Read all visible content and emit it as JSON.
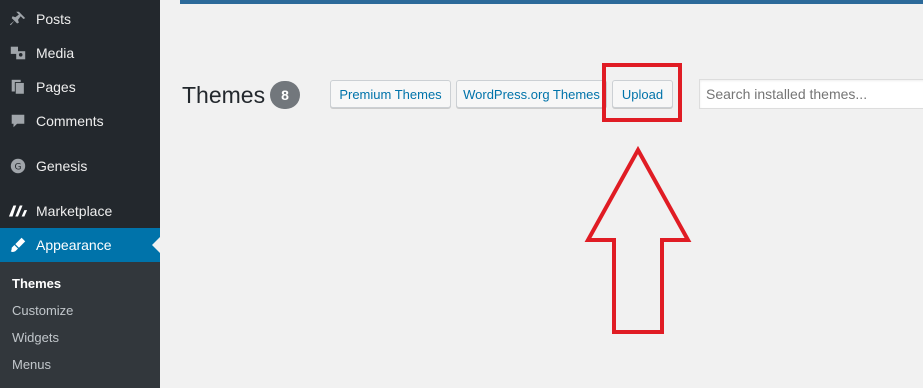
{
  "sidebar": {
    "items": [
      {
        "label": "Posts",
        "icon": "pin-icon"
      },
      {
        "label": "Media",
        "icon": "media-icon"
      },
      {
        "label": "Pages",
        "icon": "pages-icon"
      },
      {
        "label": "Comments",
        "icon": "comment-icon"
      },
      {
        "label": "Genesis",
        "icon": "genesis-icon"
      },
      {
        "label": "Marketplace",
        "icon": "marketplace-icon"
      },
      {
        "label": "Appearance",
        "icon": "paintbrush-icon",
        "active": true
      }
    ],
    "submenu": [
      {
        "label": "Themes",
        "current": true
      },
      {
        "label": "Customize"
      },
      {
        "label": "Widgets"
      },
      {
        "label": "Menus"
      }
    ]
  },
  "header": {
    "title": "Themes",
    "count": "8",
    "buttons": {
      "premium": "Premium Themes",
      "wporg": "WordPress.org Themes",
      "upload": "Upload"
    },
    "search_placeholder": "Search installed themes..."
  },
  "colors": {
    "sidebar_bg": "#23282d",
    "active_bg": "#0073aa",
    "link": "#0073aa",
    "annotation": "#e01c24"
  }
}
